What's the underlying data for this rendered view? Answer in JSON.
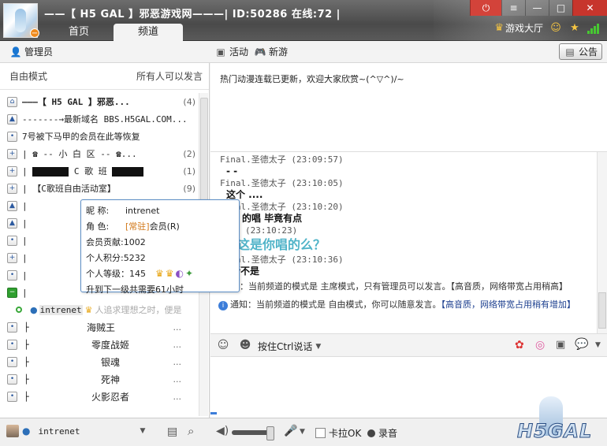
{
  "header": {
    "title": "——【 H5 GAL 】邪恶游戏网———| ID:50286 在线:72 |",
    "tabs": [
      "首页",
      "频道"
    ],
    "active_tab": 1,
    "game_hall": "游戏大厅"
  },
  "toolbar": {
    "admin": "管理员",
    "activity": "活动",
    "new_game": "新游",
    "notice": "公告"
  },
  "left": {
    "mode": "自由模式",
    "permission": "所有人可以发言",
    "rows": [
      {
        "text": "———【 H5 GAL 】邪恶...",
        "count": "(4)"
      },
      {
        "text": "-------→最新域名 BBS.H5GAL.COM...",
        "count": ""
      },
      {
        "text": "7号被下马甲的会员在此等恢复",
        "count": ""
      },
      {
        "text": "|       ☎ -- 小 白 区 -- ☎...",
        "count": "(2)"
      },
      {
        "text": "C 歌 班",
        "count": "(1)"
      },
      {
        "text": "|       【C歌班自由活动室】",
        "count": "(9)"
      }
    ],
    "current_user": "intrenet",
    "current_user_note": "人追求理想之时，便是",
    "sub_rows": [
      "海贼王",
      "零度战姬",
      "银魂",
      "死神",
      "火影忍者"
    ],
    "sub_dots": "..."
  },
  "tooltip": {
    "nick_k": "昵    称:",
    "nick_v": "intrenet",
    "role_k": "角    色:",
    "role_tag": "[常驻]",
    "role_v": "会员(R)",
    "contrib": "会员贡献:1002",
    "points": "个人积分:5232",
    "level": "个人等级：145",
    "upgrade": "升到下一级共需要61小时"
  },
  "notice_text": "热门动漫连载已更新，欢迎大家欣赏~(^▽^)/~",
  "chat": {
    "messages": [
      {
        "meta": "Final.圣德太子 (23:09:57)",
        "body": "- -"
      },
      {
        "meta": "Final.圣德太子 (23:10:05)",
        "body": "这个 ...."
      },
      {
        "meta": "Final.圣德太子 (23:10:20)",
        "body": "的唱   毕竟有点"
      },
      {
        "meta": "(23:10:23)",
        "body": "这是你唱的么？"
      },
      {
        "meta": "Final.圣德太子 (23:10:36)",
        "body": "新不是"
      }
    ],
    "sys1": "知：当前频道的模式是 主席模式，只有管理员可以发言。【高音质，网络带宽占用稍高】",
    "sys2_prefix": "通知：当前频道的模式是 自由模式，你可以随意发言。",
    "sys2_hl": "【高音质，网络带宽占用稍有增加】"
  },
  "input": {
    "ptt": "按住Ctrl说话"
  },
  "bottom": {
    "user": "intrenet",
    "karaoke": "卡拉OK",
    "record": "录音"
  },
  "colors": {
    "accent": "#2f9f2f",
    "header": "#5a5a5a",
    "tooltip_border": "#5d8fc7"
  }
}
